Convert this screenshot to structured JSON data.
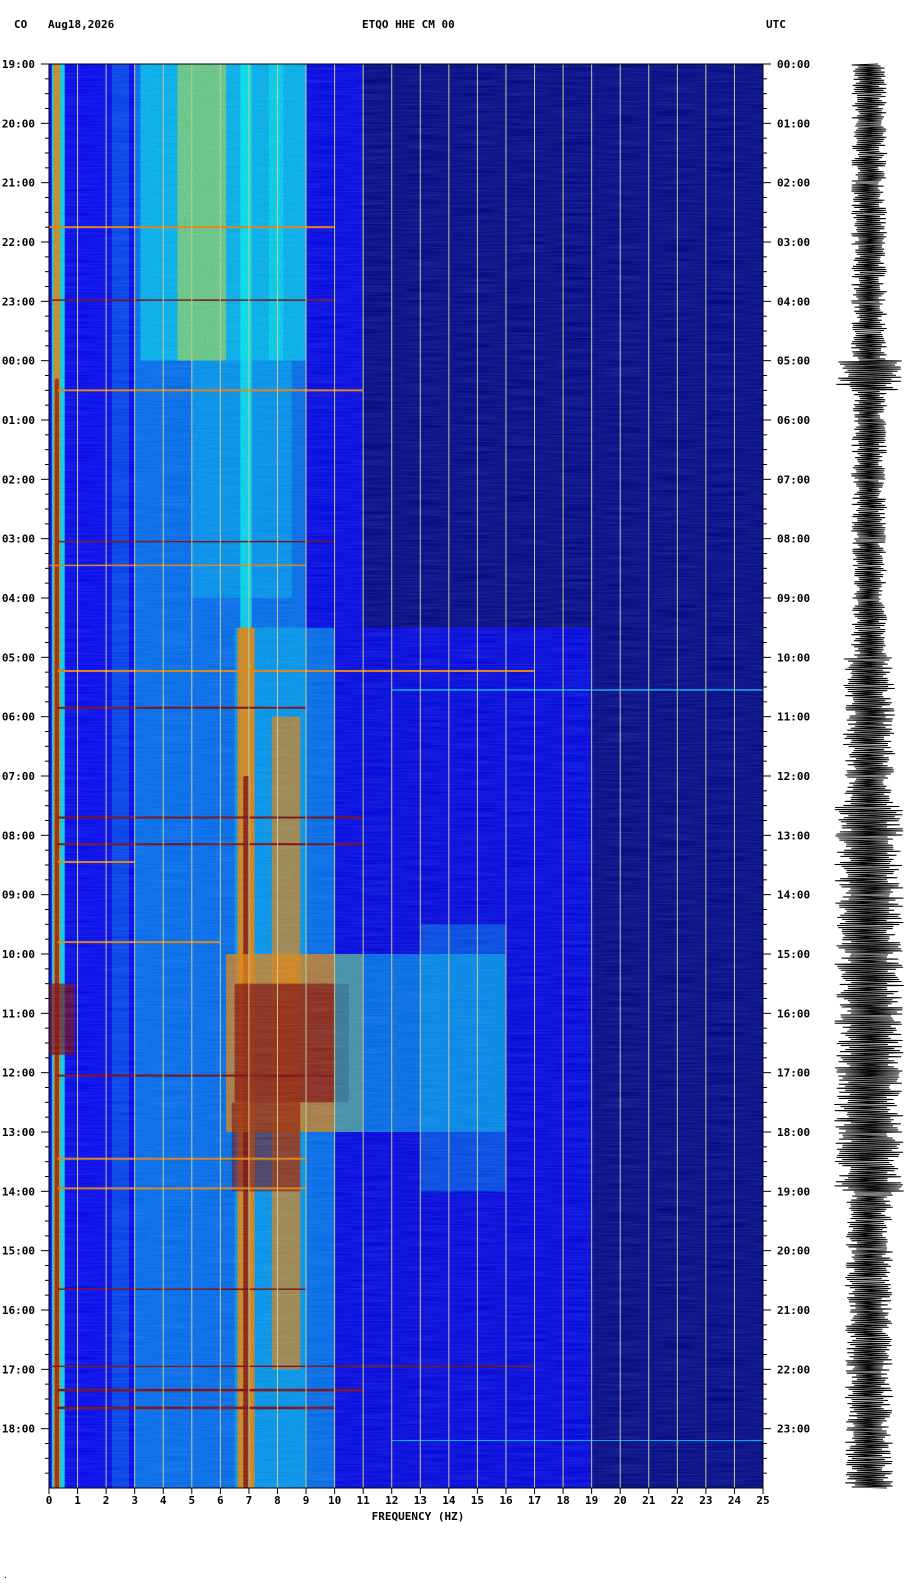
{
  "header": {
    "network": "CO",
    "date": "Aug18,2026",
    "station": "ETQO HHE CM 00",
    "timezone": "UTC"
  },
  "corner_mark": "·",
  "chart_data": {
    "type": "heatmap",
    "title": "ETQO HHE CM 00",
    "xlabel": "FREQUENCY (HZ)",
    "xlim": [
      0,
      25
    ],
    "x_ticks": [
      0,
      1,
      2,
      3,
      4,
      5,
      6,
      7,
      8,
      9,
      10,
      11,
      12,
      13,
      14,
      15,
      16,
      17,
      18,
      19,
      20,
      21,
      22,
      23,
      24,
      25
    ],
    "ylim_hours": [
      0,
      24
    ],
    "left_time_labels": [
      "19:00",
      "20:00",
      "21:00",
      "22:00",
      "23:00",
      "00:00",
      "01:00",
      "02:00",
      "03:00",
      "04:00",
      "05:00",
      "06:00",
      "07:00",
      "08:00",
      "09:00",
      "10:00",
      "11:00",
      "12:00",
      "13:00",
      "14:00",
      "15:00",
      "16:00",
      "17:00",
      "18:00"
    ],
    "right_time_labels": [
      "00:00",
      "01:00",
      "02:00",
      "03:00",
      "04:00",
      "05:00",
      "06:00",
      "07:00",
      "08:00",
      "09:00",
      "10:00",
      "11:00",
      "12:00",
      "13:00",
      "14:00",
      "15:00",
      "16:00",
      "17:00",
      "18:00",
      "19:00",
      "20:00",
      "21:00",
      "22:00",
      "23:00"
    ],
    "colormap": [
      "#00008b",
      "#0000ff",
      "#00bfff",
      "#00ffff",
      "#ffff00",
      "#ff8c00",
      "#8b0000"
    ],
    "grid_color": "#c8c896",
    "seismogram_color": "#000000"
  }
}
